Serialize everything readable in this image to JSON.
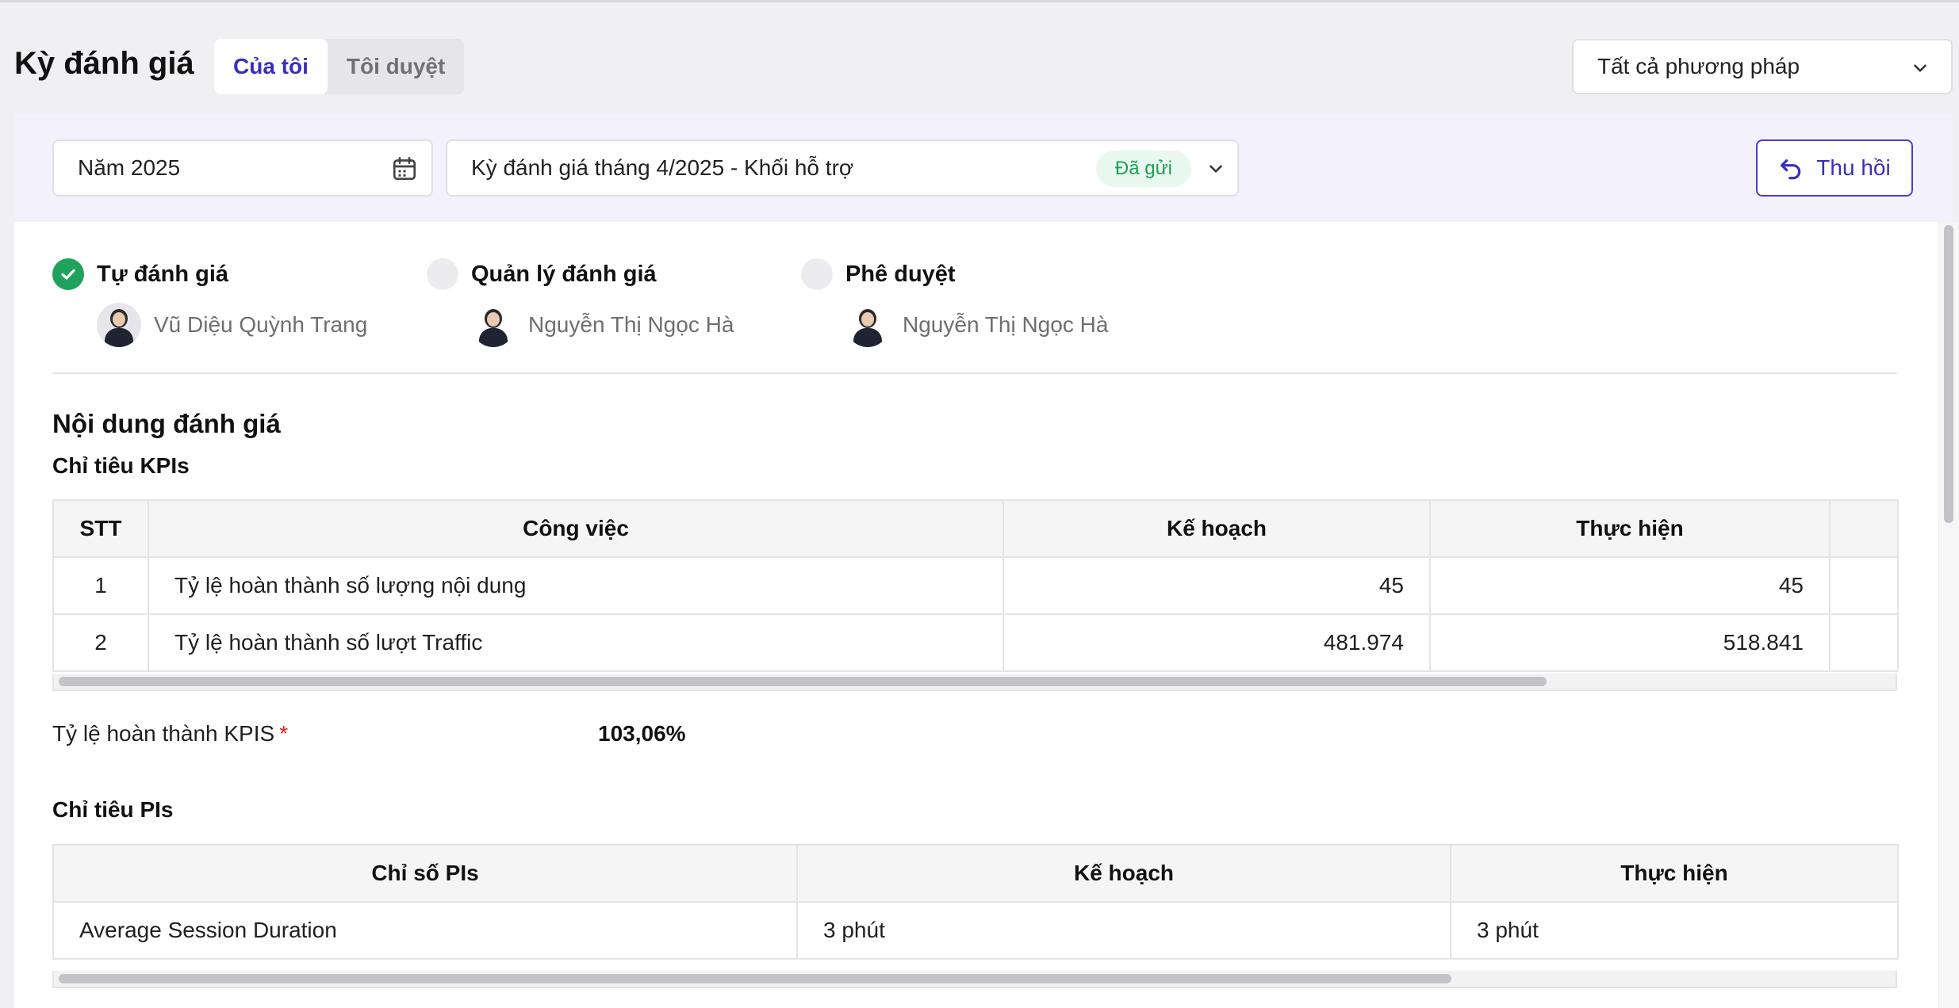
{
  "header": {
    "title": "Kỳ đánh giá",
    "tabs": [
      {
        "label": "Của tôi",
        "active": true
      },
      {
        "label": "Tôi duyệt",
        "active": false
      }
    ],
    "method_select": {
      "value": "Tất cả phương pháp"
    }
  },
  "filters": {
    "year": "Năm 2025",
    "period": "Kỳ đánh giá tháng 4/2025 - Khối hỗ trợ",
    "status": "Đã gửi",
    "recall_label": "Thu hồi"
  },
  "colors": {
    "accent": "#3b2dbd",
    "success": "#1fa25c",
    "status_bg": "#e8f8ee",
    "required": "#e02424"
  },
  "steps": [
    {
      "label": "Tự đánh giá",
      "done": true,
      "person": "Vũ Diệu Quỳnh Trang"
    },
    {
      "label": "Quản lý đánh giá",
      "done": false,
      "person": "Nguyễn Thị Ngọc Hà"
    },
    {
      "label": "Phê duyệt",
      "done": false,
      "person": "Nguyễn Thị Ngọc Hà"
    }
  ],
  "content": {
    "title": "Nội dung đánh giá",
    "kpi_section": {
      "title": "Chỉ tiêu KPIs",
      "columns": [
        "STT",
        "Công việc",
        "Kế hoạch",
        "Thực hiện"
      ],
      "rows": [
        {
          "stt": "1",
          "task": "Tỷ lệ hoàn thành số lượng nội dung",
          "plan": "45",
          "actual": "45"
        },
        {
          "stt": "2",
          "task": "Tỷ lệ hoàn thành số lượt Traffic",
          "plan": "481.974",
          "actual": "518.841"
        }
      ]
    },
    "kpi_rate": {
      "label": "Tỷ lệ hoàn thành KPIS",
      "required_mark": "*",
      "value": "103,06%"
    },
    "pi_section": {
      "title": "Chỉ tiêu PIs",
      "columns": [
        "Chỉ số PIs",
        "Kế hoạch",
        "Thực hiện"
      ],
      "rows": [
        {
          "metric": "Average Session Duration",
          "plan": "3 phút",
          "actual": "3 phút"
        }
      ]
    }
  },
  "icons": {
    "calendar": "calendar-icon",
    "chevron": "chevron-down-icon",
    "undo": "undo-arrow-icon",
    "check": "check-icon"
  }
}
